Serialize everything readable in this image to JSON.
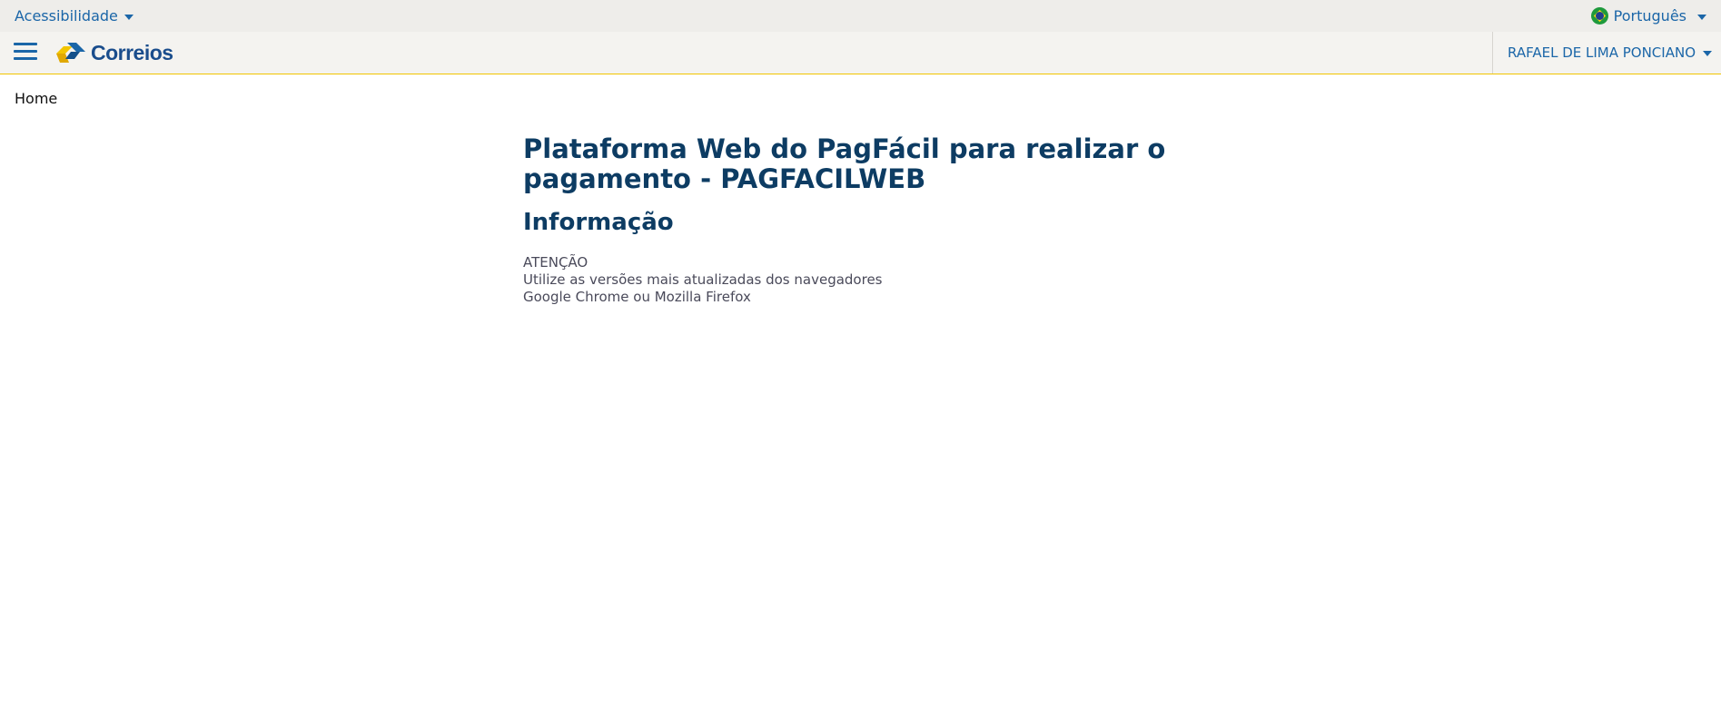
{
  "topbar": {
    "accessibility_label": "Acessibilidade",
    "language_label": "Português"
  },
  "navbar": {
    "logo_text": "Correios",
    "user_name": "RAFAEL DE LIMA PONCIANO"
  },
  "breadcrumb": {
    "home": "Home"
  },
  "main": {
    "title": "Plataforma Web do PagFácil para realizar o pagamento - PAGFACILWEB",
    "section_title": "Informação",
    "info_lines": [
      "ATENÇÃO",
      "Utilize as versões mais atualizadas dos navegadores",
      "Google Chrome ou Mozilla Firefox"
    ]
  },
  "colors": {
    "brand_blue": "#1b66a8",
    "heading_navy": "#0d3c63",
    "accent_yellow": "#f2c500"
  }
}
